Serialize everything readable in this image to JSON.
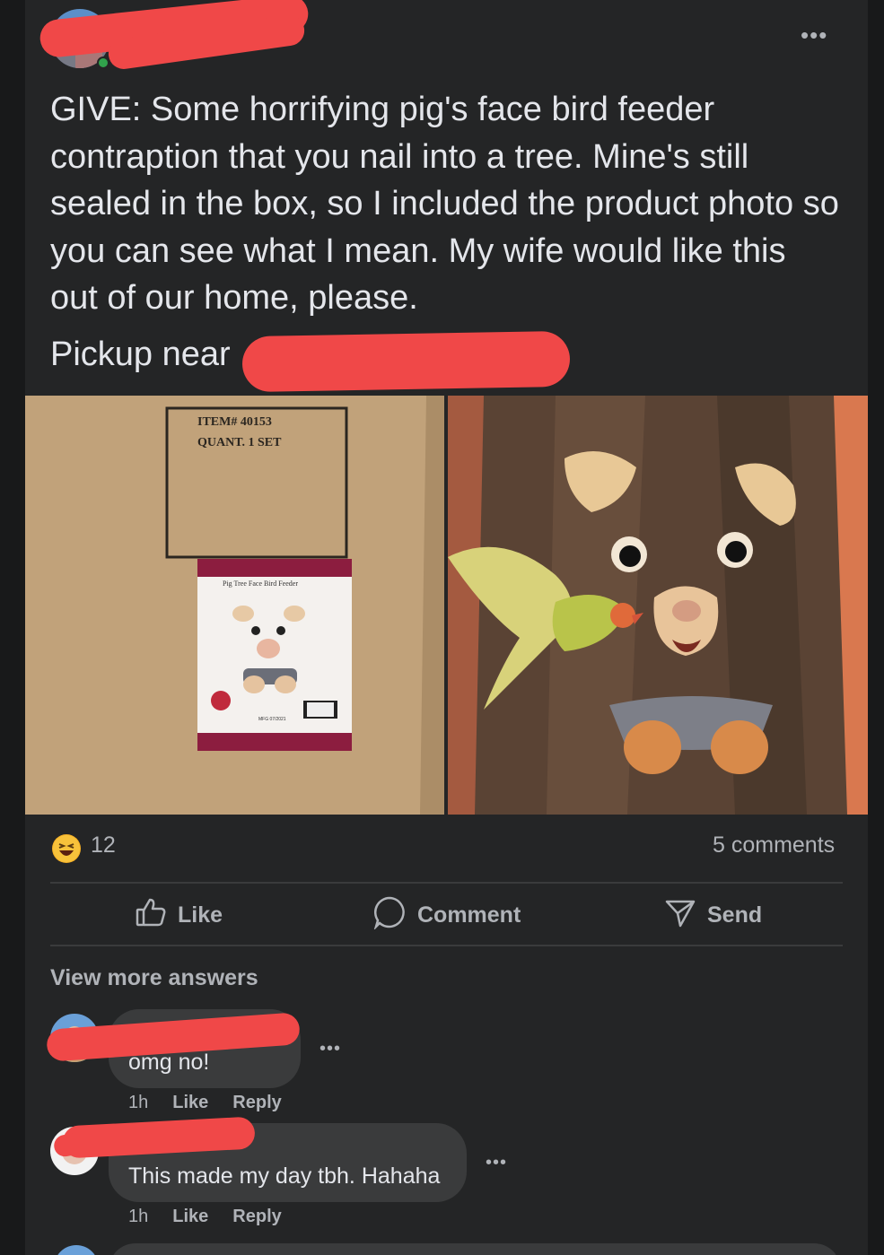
{
  "post": {
    "author": {
      "name_redacted": true
    },
    "text": "GIVE: Some horrifying pig's face bird feeder contraption that you nail into a tree. Mine's still sealed in the box, so I included the product photo so you can see what I mean. My wife would like this out of our home, please.",
    "pickup_label": "Pickup near",
    "photos": [
      {
        "subject": "cardboard box with product photo",
        "label_item": "ITEM# 40153",
        "label_quant": "QUANT. 1 SET",
        "card_title": "Pig Tree Face Bird Feeder",
        "card_code": "MFG 07/2021"
      },
      {
        "subject": "pig face bird feeder on tree with lovebird"
      }
    ],
    "reaction_count": "12",
    "reaction_icon": "laughing-emoji-icon",
    "comments_count": "5 comments"
  },
  "actions": {
    "like": "Like",
    "comment": "Comment",
    "send": "Send"
  },
  "comments_section": {
    "view_more": "View more answers",
    "comments": [
      {
        "text": "omg no!",
        "time": "1h",
        "like": "Like",
        "reply": "Reply"
      },
      {
        "text": "This made my day tbh. Hahaha",
        "time": "1h",
        "like": "Like",
        "reply": "Reply"
      }
    ]
  },
  "colors": {
    "background": "#18191a",
    "card": "#242526",
    "bubble": "#3a3b3c",
    "text": "#e4e6eb",
    "secondary_text": "#b0b3b8",
    "redaction": "#f04848"
  }
}
